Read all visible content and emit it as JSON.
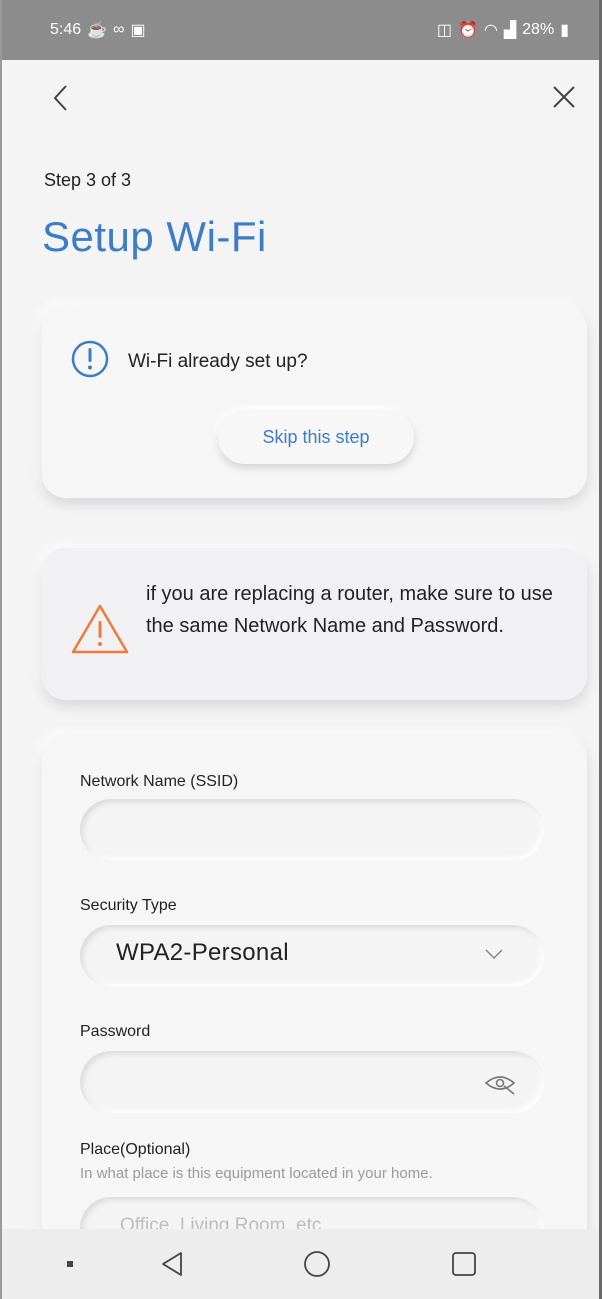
{
  "status_bar": {
    "time": "5:46",
    "battery": "28%"
  },
  "header": {
    "step": "Step 3 of 3",
    "title": "Setup Wi-Fi"
  },
  "info_card": {
    "question": "Wi-Fi already set up?",
    "skip_label": "Skip this step"
  },
  "warning_card": {
    "message": "if you are replacing a router, make sure to use the same Network Name and Password."
  },
  "form": {
    "ssid": {
      "label": "Network Name (SSID)",
      "value": ""
    },
    "security": {
      "label": "Security Type",
      "value": "WPA2-Personal"
    },
    "password": {
      "label": "Password",
      "value": ""
    },
    "place": {
      "label": "Place(Optional)",
      "hint": "In what place is this equipment located in your home.",
      "placeholder": "Office, Living Room, etc"
    }
  },
  "colors": {
    "accent": "#3d7cc6",
    "warning": "#f07a3c"
  },
  "icons": [
    "back-arrow-icon",
    "close-icon",
    "info-icon",
    "warning-icon",
    "chevron-down-icon",
    "eye-hidden-icon",
    "nav-back-icon",
    "nav-home-icon",
    "nav-recents-icon"
  ]
}
